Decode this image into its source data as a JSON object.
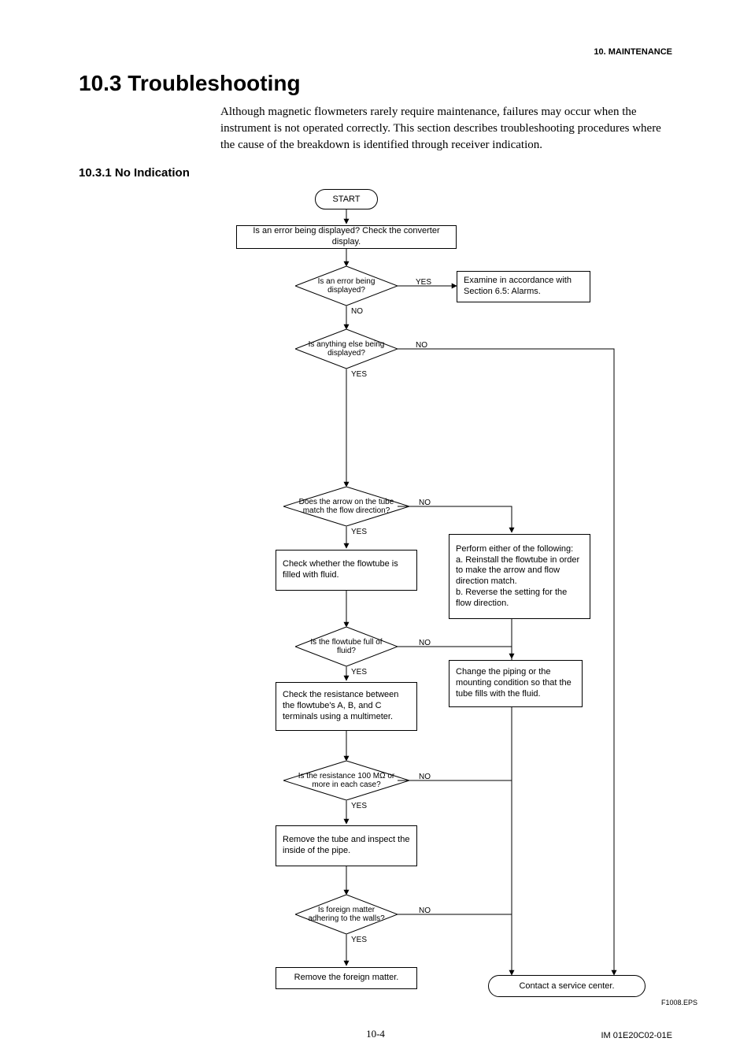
{
  "header": {
    "running": "10.  MAINTENANCE"
  },
  "section": {
    "title": "10.3 Troubleshooting",
    "intro": "Although magnetic flowmeters rarely require maintenance, failures may occur when the instrument is not operated correctly. This section describes troubleshooting procedures where the cause of the breakdown is identified through receiver indication.",
    "sub": "10.3.1  No Indication"
  },
  "flow": {
    "start": "START",
    "check_display": "Is an error being displayed? Check the converter display.",
    "d_error": "Is an error being displayed?",
    "examine_alarms": "Examine in accordance with Section 6.5: Alarms.",
    "d_anything": "Is anything else being displayed?",
    "d_arrow": "Does the arrow on the tube match the flow direction?",
    "perform": "Perform either of the following:\na. Reinstall the flowtube in order to make the arrow and flow direction match.\nb. Reverse the setting for the flow direction.",
    "check_fluid": "Check whether the flowtube is filled with fluid.",
    "d_full": "Is the flowtube full of fluid?",
    "change_piping": "Change the piping or the mounting condition so that the tube fills with the fluid.",
    "check_resistance": "Check the resistance between the flowtube's A, B, and C terminals using a multimeter.",
    "d_resistance": "Is the resistance 100 MΩ or more in each case?",
    "remove_inspect": "Remove the tube and inspect the inside of the pipe.",
    "d_foreign": "Is foreign matter adhering to the walls?",
    "remove_foreign": "Remove the foreign matter.",
    "contact": "Contact a service center.",
    "labels": {
      "yes": "YES",
      "no": "NO"
    },
    "figref": "F1008.EPS"
  },
  "footer": {
    "page": "10-4",
    "doc": "IM 01E20C02-01E"
  }
}
